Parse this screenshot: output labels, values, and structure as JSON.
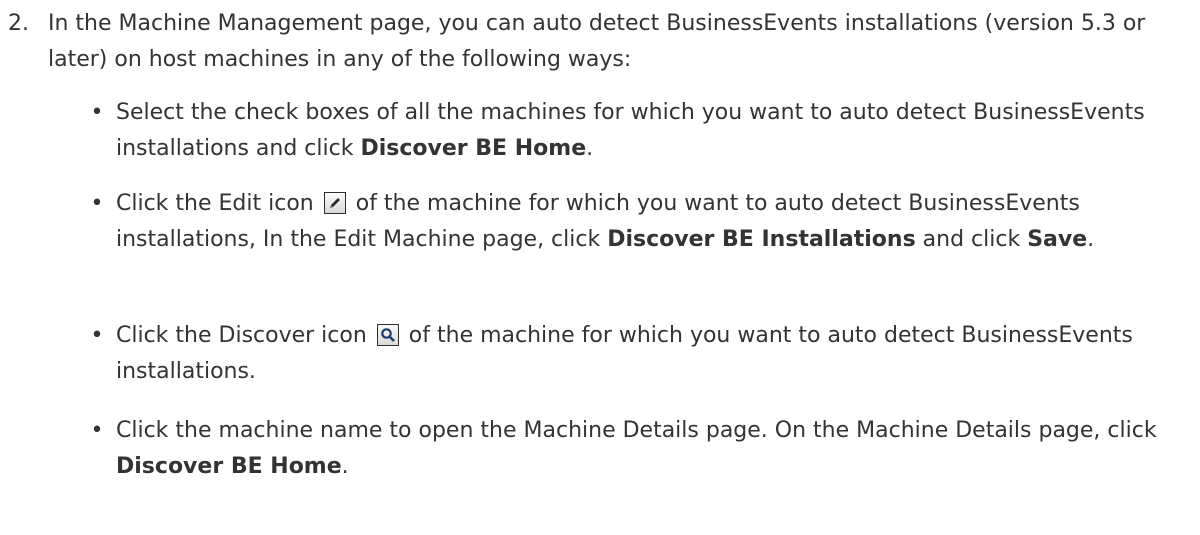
{
  "step": {
    "number": "2.",
    "text": "In the Machine Management page, you can auto detect BusinessEvents installations (version 5.3 or later) on host machines in any of the following ways:"
  },
  "bullets": [
    {
      "before": "Select the check boxes of all the machines for which you want to auto detect BusinessEvents installations and click ",
      "bold": "Discover BE Home",
      "after": "."
    },
    {
      "before": "Click the Edit icon",
      "icon": "pencil-icon",
      "middle": "of the machine for which you want to auto detect BusinessEvents installations, In the Edit Machine page, click ",
      "bold1": "Discover BE Installations",
      "mid2": " and click ",
      "bold2": "Save",
      "after": "."
    },
    {
      "before": "Click the Discover icon",
      "icon": "magnifier-icon",
      "middle": "of the machine for which you want to auto detect BusinessEvents installations."
    },
    {
      "before": "Click the machine name to open the Machine Details page. On the Machine Details page, click ",
      "bold": "Discover BE Home",
      "after": "."
    }
  ]
}
